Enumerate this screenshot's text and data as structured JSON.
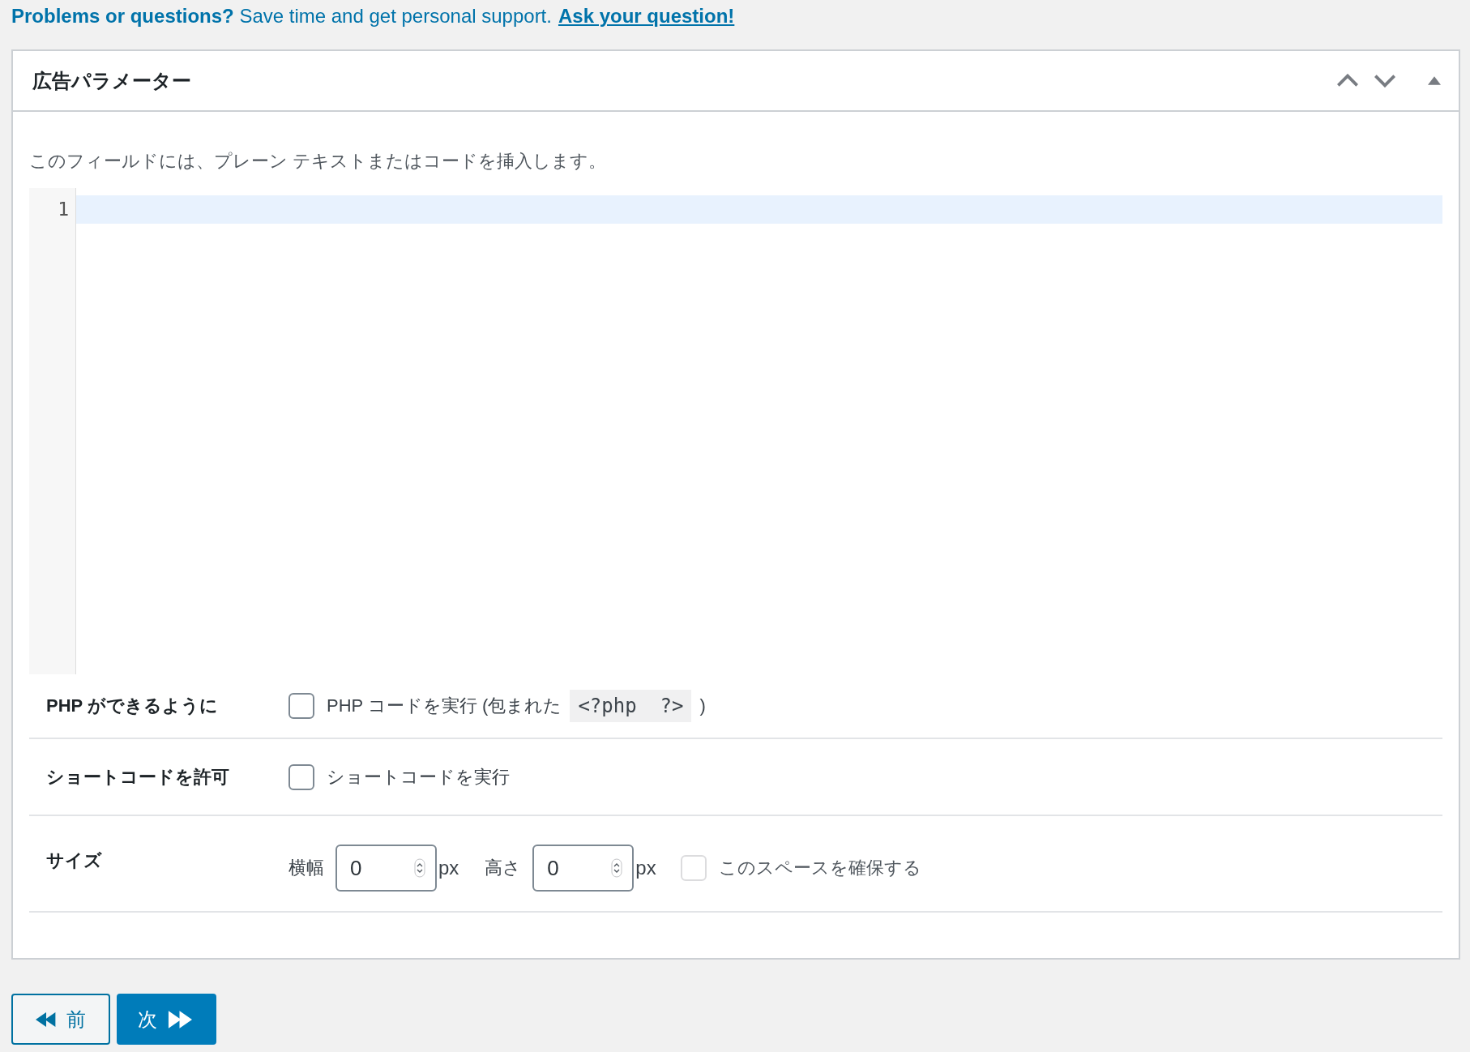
{
  "notice": {
    "text": "**Problems or questions?** Save time and get personal support.",
    "link": "Ask your question!"
  },
  "panel": {
    "title": "広告パラメーター",
    "description": "このフィールドには、プレーン テキストまたはコードを挿入します。",
    "editor": {
      "line_numbers": [
        "1"
      ]
    },
    "rows": [
      {
        "kind": "checkbox",
        "label": "PHP ができるように",
        "option": {
          "text": "PHP コードを実行 (包まれた",
          "code": "<?php  ?>",
          "suffix": ")",
          "checked": false
        }
      },
      {
        "kind": "checkbox",
        "label": "ショートコードを許可",
        "option": {
          "text": "ショートコードを実行",
          "checked": false
        }
      },
      {
        "kind": "size",
        "label": "サイズ",
        "fields": [
          {
            "label": "横幅",
            "value": "0",
            "unit": "px"
          },
          {
            "label": "高さ",
            "value": "0",
            "unit": "px"
          }
        ],
        "reserve": {
          "text": "このスペースを確保する",
          "checked": false,
          "disabled": true
        }
      }
    ]
  },
  "buttons": [
    {
      "kind": "prev",
      "label": "前"
    },
    {
      "kind": "next",
      "label": "次"
    }
  ]
}
